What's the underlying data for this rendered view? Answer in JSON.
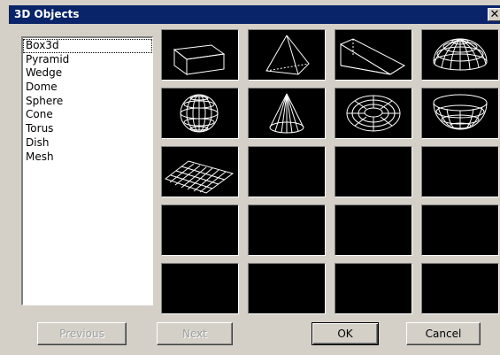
{
  "window": {
    "title": "3D Objects",
    "close_label": "✕"
  },
  "list": {
    "items": [
      "Box3d",
      "Pyramid",
      "Wedge",
      "Dome",
      "Sphere",
      "Cone",
      "Torus",
      "Dish",
      "Mesh"
    ],
    "selected": "Box3d"
  },
  "tiles": [
    {
      "name": "box3d"
    },
    {
      "name": "pyramid"
    },
    {
      "name": "wedge"
    },
    {
      "name": "dome"
    },
    {
      "name": "sphere"
    },
    {
      "name": "cone"
    },
    {
      "name": "torus"
    },
    {
      "name": "dish"
    },
    {
      "name": "mesh"
    },
    {
      "name": "empty"
    },
    {
      "name": "empty"
    },
    {
      "name": "empty"
    },
    {
      "name": "empty"
    },
    {
      "name": "empty"
    },
    {
      "name": "empty"
    },
    {
      "name": "empty"
    },
    {
      "name": "empty"
    },
    {
      "name": "empty"
    },
    {
      "name": "empty"
    },
    {
      "name": "empty"
    }
  ],
  "buttons": {
    "previous": "Previous",
    "next": "Next",
    "ok": "OK",
    "cancel": "Cancel"
  },
  "colors": {
    "titlebar": "#0a246a",
    "face": "#d4d0c8",
    "tile_bg": "#000000",
    "wireframe": "#ffffff"
  }
}
